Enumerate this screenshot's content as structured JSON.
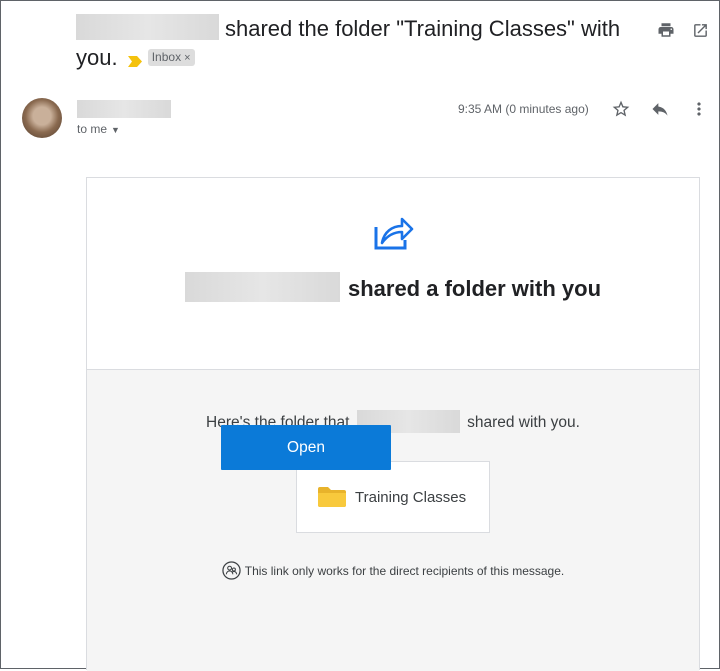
{
  "subject": {
    "text": "shared the folder \"Training Classes\" with you.",
    "label_chip": "Inbox",
    "label_chip_close": "×"
  },
  "top_actions": [
    {
      "icon": "print-icon"
    },
    {
      "icon": "open-in-new-window-icon"
    }
  ],
  "message": {
    "recipient_text": "to me",
    "timestamp": "9:35 AM (0 minutes ago)",
    "actions": [
      {
        "icon": "star-icon"
      },
      {
        "icon": "reply-icon"
      },
      {
        "icon": "more-options-icon"
      }
    ]
  },
  "email_body": {
    "headline": "shared a folder with you",
    "folder_intro_prefix": "Here's the folder that",
    "folder_intro_suffix": "shared with you.",
    "folder_name": "Training Classes",
    "link_note": "This link only works for the direct recipients of this message.",
    "open_button": "Open"
  },
  "colors": {
    "open_button": "#0b7ad8",
    "share_icon": "#1a73e8",
    "folder_icon": "#f8c93c",
    "important_marker": "#f4c20d"
  }
}
